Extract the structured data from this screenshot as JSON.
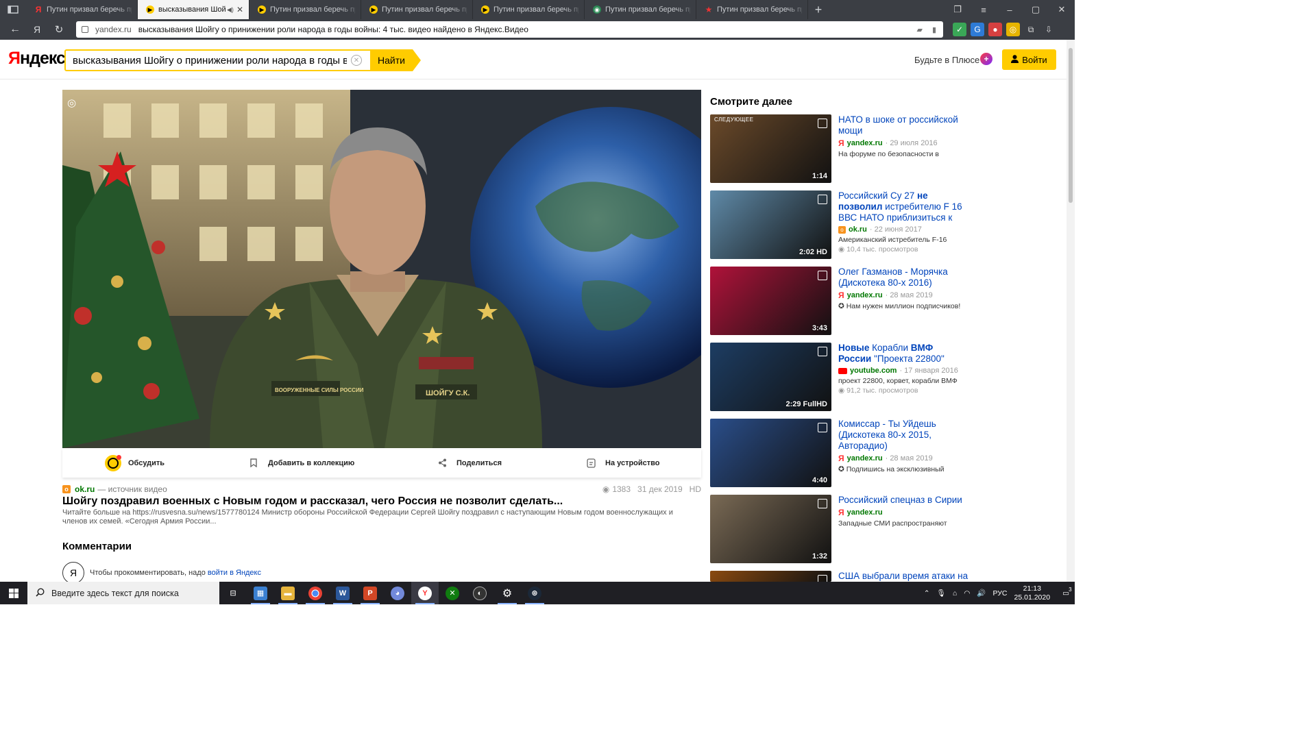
{
  "browser": {
    "tabs": [
      {
        "title": "Путин призвал беречь пр",
        "favicon": "yandex",
        "active": false
      },
      {
        "title": "высказывания Шойг",
        "favicon": "yandex-video",
        "active": true
      },
      {
        "title": "Путин призвал беречь пр",
        "favicon": "yandex-video",
        "active": false
      },
      {
        "title": "Путин призвал беречь пр",
        "favicon": "yandex-video",
        "active": false
      },
      {
        "title": "Путин призвал беречь пр",
        "favicon": "yandex-video",
        "active": false
      },
      {
        "title": "Путин призвал беречь пр",
        "favicon": "green",
        "active": false
      },
      {
        "title": "Путин призвал беречь пр",
        "favicon": "star",
        "active": false
      }
    ],
    "address": {
      "host": "yandex.ru",
      "path": "высказывания Шойгу о принижении роли народа в годы войны: 4 тыс. видео найдено в Яндекс.Видео"
    },
    "nav_logo": "Я"
  },
  "header": {
    "logo_first": "Я",
    "logo_rest": "ндекс",
    "search_value": "высказывания Шойгу о принижении роли народа в годы войны",
    "search_button": "Найти",
    "plus_link": "Будьте в Плюсе",
    "login_button": "Войти"
  },
  "player": {
    "actions": {
      "discuss": "Обсудить",
      "collect": "Добавить в коллекцию",
      "share": "Поделиться",
      "device": "На устройство"
    },
    "patch_left": "ВООРУЖЕННЫЕ СИЛЫ РОССИИ",
    "patch_right": "ШОЙГУ С.К."
  },
  "video": {
    "source_host": "ok.ru",
    "source_label": "— источник видео",
    "views": "1383",
    "date": "31 дек 2019",
    "quality": "HD",
    "title": "Шойгу поздравил военных с Новым годом и рассказал, чего Россия не позволит сделать...",
    "description": "Читайте больше на https://rusvesna.su/news/1577780124 Министр обороны Российской Федерации Сергей Шойгу поздравил с наступающим Новым годом военнослужащих и членов их семей. «Сегодня Армия России..."
  },
  "comments": {
    "heading": "Комментарии",
    "avatar": "Я",
    "hint": "Чтобы прокомментировать, надо ",
    "hint_link": "войти в Яндекс"
  },
  "related": {
    "heading": "Смотрите далее",
    "next_label": "СЛЕДУЮЩЕЕ",
    "items": [
      {
        "title_parts": [
          {
            "t": "НАТО в шоке от российской мощи",
            "b": false
          }
        ],
        "host": "yandex.ru",
        "src": "yandex",
        "date": "· 29 июля 2016",
        "desc": "На форуме по безопасности в",
        "views": "",
        "duration": "1:14",
        "bg": "#6b4a2a"
      },
      {
        "title_parts": [
          {
            "t": "Российский Су 27 ",
            "b": false
          },
          {
            "t": "не позволил",
            "b": true
          },
          {
            "t": " истребителю F 16 ВВС НАТО приблизиться к",
            "b": false
          }
        ],
        "host": "ok.ru",
        "src": "ok",
        "date": "· 22 июня 2017",
        "desc": "Американский истребитель F-16",
        "views": "10,4 тыс. просмотров",
        "duration": "2:02 HD",
        "bg": "#5f8aa8"
      },
      {
        "title_parts": [
          {
            "t": "Олег Газманов - Морячка (Дискотека 80-х 2016)",
            "b": false
          }
        ],
        "host": "yandex.ru",
        "src": "yandex",
        "date": "· 28 мая 2019",
        "desc": "✪ Нам нужен миллион подписчиков!",
        "views": "",
        "duration": "3:43",
        "bg": "#b0123a"
      },
      {
        "title_parts": [
          {
            "t": "Новые",
            "b": true
          },
          {
            "t": " Корабли ",
            "b": false
          },
          {
            "t": "ВМФ России",
            "b": true
          },
          {
            "t": " \"Проекта 22800\"",
            "b": false
          }
        ],
        "host": "youtube.com",
        "src": "youtube",
        "date": "· 17 января 2016",
        "desc": "проект 22800, корвет, корабли ВМФ",
        "views": "91,2 тыс. просмотров",
        "duration": "2:29 FullHD",
        "bg": "#1d3d63"
      },
      {
        "title_parts": [
          {
            "t": "Комиссар - Ты Уйдешь (Дискотека 80-х 2015, Авторадио)",
            "b": false
          }
        ],
        "host": "yandex.ru",
        "src": "yandex",
        "date": "· 28 мая 2019",
        "desc": "✪ Подпишись на эксклюзивный",
        "views": "",
        "duration": "4:40",
        "bg": "#2a4e8a"
      },
      {
        "title_parts": [
          {
            "t": "Российский спецназ в Сирии",
            "b": false
          }
        ],
        "host": "yandex.ru",
        "src": "yandex",
        "date": "",
        "desc": "Западные СМИ распространяют",
        "views": "",
        "duration": "1:32",
        "bg": "#7a6a55"
      },
      {
        "title_parts": [
          {
            "t": "США выбрали время атаки на",
            "b": false
          }
        ],
        "host": "",
        "src": "",
        "date": "",
        "desc": "",
        "views": "",
        "duration": "",
        "bg": "#8a4a10"
      }
    ]
  },
  "taskbar": {
    "search_placeholder": "Введите здесь текст для поиска",
    "lang": "РУС",
    "time": "21:13",
    "date": "25.01.2020",
    "notifications": "3"
  },
  "colors": {
    "accent": "#ffcc00",
    "link": "#0044bb",
    "host_green": "#007700"
  }
}
